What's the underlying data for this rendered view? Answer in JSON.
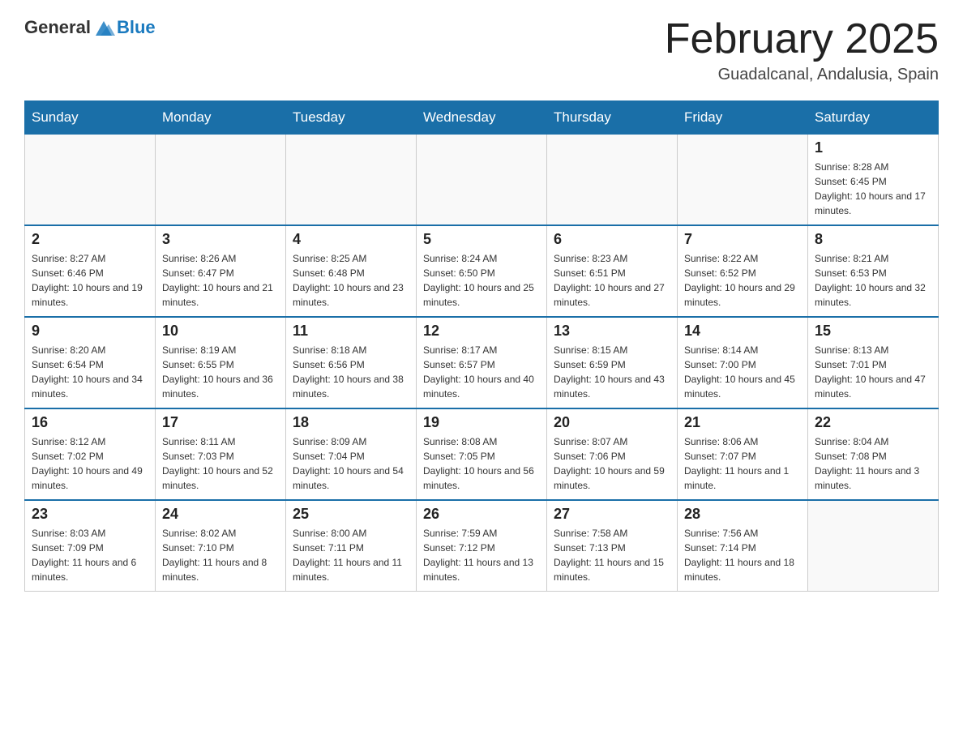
{
  "header": {
    "logo_general": "General",
    "logo_blue": "Blue",
    "title": "February 2025",
    "subtitle": "Guadalcanal, Andalusia, Spain"
  },
  "days_of_week": [
    "Sunday",
    "Monday",
    "Tuesday",
    "Wednesday",
    "Thursday",
    "Friday",
    "Saturday"
  ],
  "weeks": [
    {
      "days": [
        {
          "num": "",
          "info": ""
        },
        {
          "num": "",
          "info": ""
        },
        {
          "num": "",
          "info": ""
        },
        {
          "num": "",
          "info": ""
        },
        {
          "num": "",
          "info": ""
        },
        {
          "num": "",
          "info": ""
        },
        {
          "num": "1",
          "info": "Sunrise: 8:28 AM\nSunset: 6:45 PM\nDaylight: 10 hours and 17 minutes."
        }
      ]
    },
    {
      "days": [
        {
          "num": "2",
          "info": "Sunrise: 8:27 AM\nSunset: 6:46 PM\nDaylight: 10 hours and 19 minutes."
        },
        {
          "num": "3",
          "info": "Sunrise: 8:26 AM\nSunset: 6:47 PM\nDaylight: 10 hours and 21 minutes."
        },
        {
          "num": "4",
          "info": "Sunrise: 8:25 AM\nSunset: 6:48 PM\nDaylight: 10 hours and 23 minutes."
        },
        {
          "num": "5",
          "info": "Sunrise: 8:24 AM\nSunset: 6:50 PM\nDaylight: 10 hours and 25 minutes."
        },
        {
          "num": "6",
          "info": "Sunrise: 8:23 AM\nSunset: 6:51 PM\nDaylight: 10 hours and 27 minutes."
        },
        {
          "num": "7",
          "info": "Sunrise: 8:22 AM\nSunset: 6:52 PM\nDaylight: 10 hours and 29 minutes."
        },
        {
          "num": "8",
          "info": "Sunrise: 8:21 AM\nSunset: 6:53 PM\nDaylight: 10 hours and 32 minutes."
        }
      ]
    },
    {
      "days": [
        {
          "num": "9",
          "info": "Sunrise: 8:20 AM\nSunset: 6:54 PM\nDaylight: 10 hours and 34 minutes."
        },
        {
          "num": "10",
          "info": "Sunrise: 8:19 AM\nSunset: 6:55 PM\nDaylight: 10 hours and 36 minutes."
        },
        {
          "num": "11",
          "info": "Sunrise: 8:18 AM\nSunset: 6:56 PM\nDaylight: 10 hours and 38 minutes."
        },
        {
          "num": "12",
          "info": "Sunrise: 8:17 AM\nSunset: 6:57 PM\nDaylight: 10 hours and 40 minutes."
        },
        {
          "num": "13",
          "info": "Sunrise: 8:15 AM\nSunset: 6:59 PM\nDaylight: 10 hours and 43 minutes."
        },
        {
          "num": "14",
          "info": "Sunrise: 8:14 AM\nSunset: 7:00 PM\nDaylight: 10 hours and 45 minutes."
        },
        {
          "num": "15",
          "info": "Sunrise: 8:13 AM\nSunset: 7:01 PM\nDaylight: 10 hours and 47 minutes."
        }
      ]
    },
    {
      "days": [
        {
          "num": "16",
          "info": "Sunrise: 8:12 AM\nSunset: 7:02 PM\nDaylight: 10 hours and 49 minutes."
        },
        {
          "num": "17",
          "info": "Sunrise: 8:11 AM\nSunset: 7:03 PM\nDaylight: 10 hours and 52 minutes."
        },
        {
          "num": "18",
          "info": "Sunrise: 8:09 AM\nSunset: 7:04 PM\nDaylight: 10 hours and 54 minutes."
        },
        {
          "num": "19",
          "info": "Sunrise: 8:08 AM\nSunset: 7:05 PM\nDaylight: 10 hours and 56 minutes."
        },
        {
          "num": "20",
          "info": "Sunrise: 8:07 AM\nSunset: 7:06 PM\nDaylight: 10 hours and 59 minutes."
        },
        {
          "num": "21",
          "info": "Sunrise: 8:06 AM\nSunset: 7:07 PM\nDaylight: 11 hours and 1 minute."
        },
        {
          "num": "22",
          "info": "Sunrise: 8:04 AM\nSunset: 7:08 PM\nDaylight: 11 hours and 3 minutes."
        }
      ]
    },
    {
      "days": [
        {
          "num": "23",
          "info": "Sunrise: 8:03 AM\nSunset: 7:09 PM\nDaylight: 11 hours and 6 minutes."
        },
        {
          "num": "24",
          "info": "Sunrise: 8:02 AM\nSunset: 7:10 PM\nDaylight: 11 hours and 8 minutes."
        },
        {
          "num": "25",
          "info": "Sunrise: 8:00 AM\nSunset: 7:11 PM\nDaylight: 11 hours and 11 minutes."
        },
        {
          "num": "26",
          "info": "Sunrise: 7:59 AM\nSunset: 7:12 PM\nDaylight: 11 hours and 13 minutes."
        },
        {
          "num": "27",
          "info": "Sunrise: 7:58 AM\nSunset: 7:13 PM\nDaylight: 11 hours and 15 minutes."
        },
        {
          "num": "28",
          "info": "Sunrise: 7:56 AM\nSunset: 7:14 PM\nDaylight: 11 hours and 18 minutes."
        },
        {
          "num": "",
          "info": ""
        }
      ]
    }
  ]
}
